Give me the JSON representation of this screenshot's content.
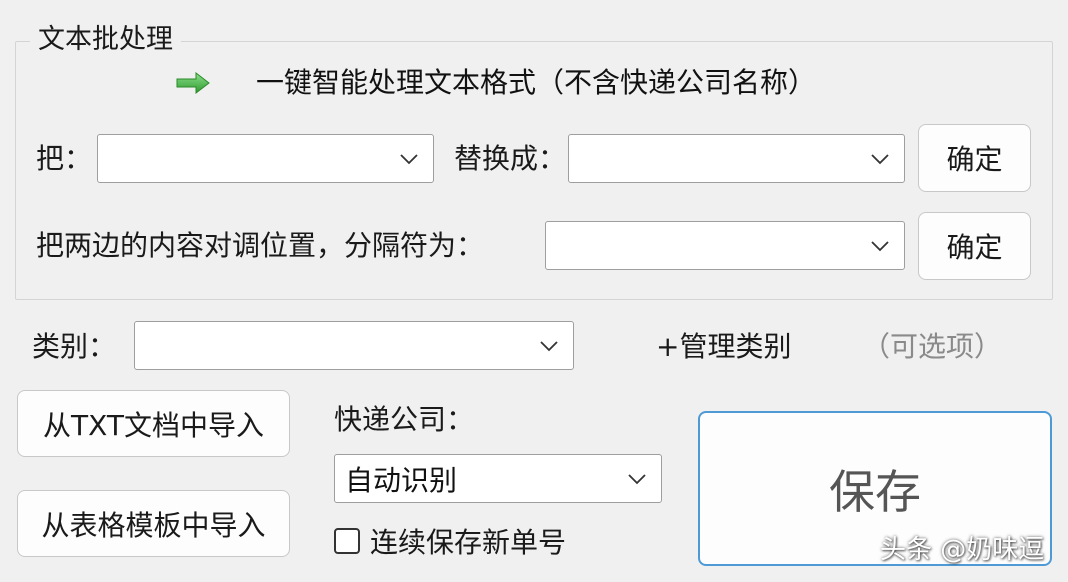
{
  "group": {
    "title": "文本批处理",
    "smart_process_label": "一键智能处理文本格式（不含快递公司名称）",
    "replace_row": {
      "from_label": "把：",
      "from_value": "",
      "to_label": "替换成：",
      "to_value": "",
      "confirm_label": "确定"
    },
    "swap_row": {
      "label": "把两边的内容对调位置，分隔符为：",
      "separator_value": "",
      "confirm_label": "确定"
    }
  },
  "category": {
    "label": "类别：",
    "value": "",
    "manage_label": "+管理类别",
    "optional_label": "（可选项）"
  },
  "import": {
    "txt_label": "从TXT文档中导入",
    "table_label": "从表格模板中导入"
  },
  "express": {
    "label": "快递公司：",
    "selected": "自动识别",
    "continuous_label": "连续保存新单号",
    "continuous_checked": false
  },
  "save_label": "保存",
  "watermark": "头条 @奶味逗",
  "colors": {
    "arrow": "#3fae3f",
    "save_border": "#4e9ad6",
    "background": "#f0f0f0"
  },
  "icons": {
    "smart_arrow": "green-right-arrow-icon",
    "dropdown": "chevron-down-icon"
  }
}
